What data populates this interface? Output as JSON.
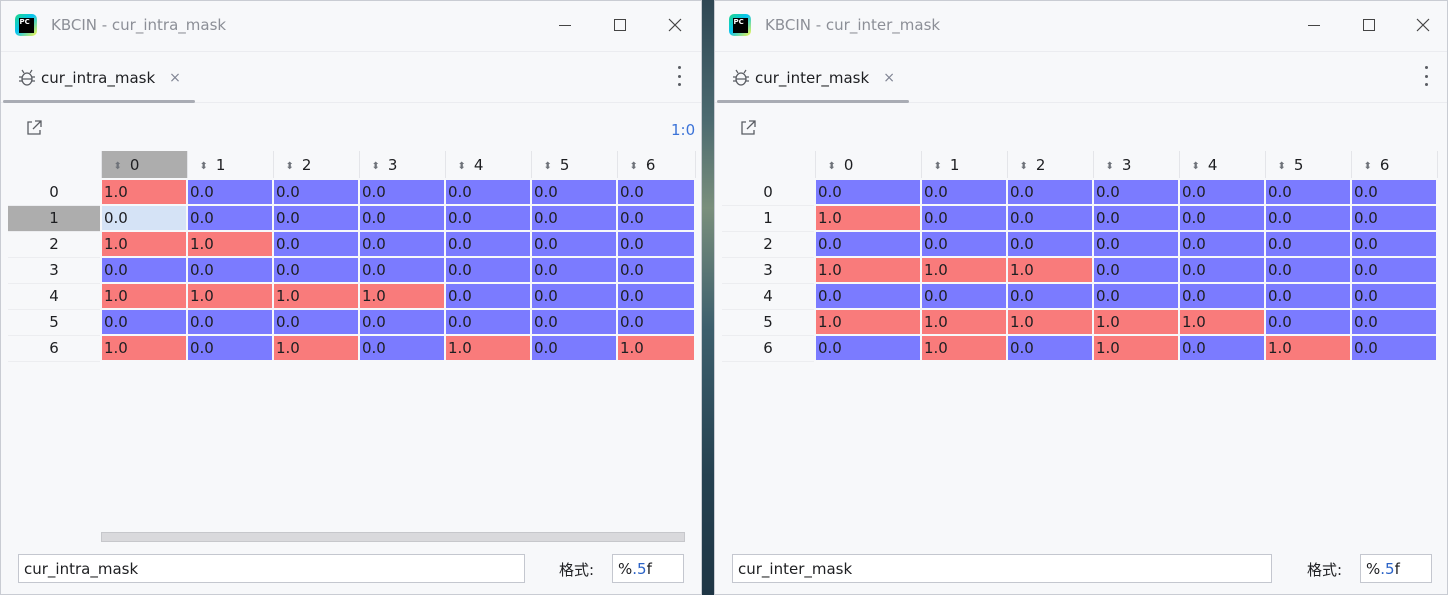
{
  "colors": {
    "one": "#f97b7b",
    "zero": "#7b7bff",
    "selected_cell": "#d5e3f6",
    "header_selected": "#adadad"
  },
  "left": {
    "window_title": "KBCIN - cur_intra_mask",
    "tab_label": "cur_intra_mask",
    "tab_close": "×",
    "ratio": "1:0",
    "columns": [
      "0",
      "1",
      "2",
      "3",
      "4",
      "5",
      "6"
    ],
    "rows": [
      {
        "index": "0",
        "cells": [
          "1.0",
          "0.0",
          "0.0",
          "0.0",
          "0.0",
          "0.0",
          "0.0"
        ]
      },
      {
        "index": "1",
        "cells": [
          "0.0",
          "0.0",
          "0.0",
          "0.0",
          "0.0",
          "0.0",
          "0.0"
        ]
      },
      {
        "index": "2",
        "cells": [
          "1.0",
          "1.0",
          "0.0",
          "0.0",
          "0.0",
          "0.0",
          "0.0"
        ]
      },
      {
        "index": "3",
        "cells": [
          "0.0",
          "0.0",
          "0.0",
          "0.0",
          "0.0",
          "0.0",
          "0.0"
        ]
      },
      {
        "index": "4",
        "cells": [
          "1.0",
          "1.0",
          "1.0",
          "1.0",
          "0.0",
          "0.0",
          "0.0"
        ]
      },
      {
        "index": "5",
        "cells": [
          "0.0",
          "0.0",
          "0.0",
          "0.0",
          "0.0",
          "0.0",
          "0.0"
        ]
      },
      {
        "index": "6",
        "cells": [
          "1.0",
          "0.0",
          "1.0",
          "0.0",
          "1.0",
          "0.0",
          "1.0"
        ]
      }
    ],
    "expression": "cur_intra_mask",
    "format_label": "格式:",
    "format_prefix": "%",
    "format_number": ".5",
    "format_suffix": "f"
  },
  "right": {
    "window_title": "KBCIN - cur_inter_mask",
    "tab_label": "cur_inter_mask",
    "tab_close": "×",
    "columns": [
      "0",
      "1",
      "2",
      "3",
      "4",
      "5",
      "6"
    ],
    "rows": [
      {
        "index": "0",
        "cells": [
          "0.0",
          "0.0",
          "0.0",
          "0.0",
          "0.0",
          "0.0",
          "0.0"
        ]
      },
      {
        "index": "1",
        "cells": [
          "1.0",
          "0.0",
          "0.0",
          "0.0",
          "0.0",
          "0.0",
          "0.0"
        ]
      },
      {
        "index": "2",
        "cells": [
          "0.0",
          "0.0",
          "0.0",
          "0.0",
          "0.0",
          "0.0",
          "0.0"
        ]
      },
      {
        "index": "3",
        "cells": [
          "1.0",
          "1.0",
          "1.0",
          "0.0",
          "0.0",
          "0.0",
          "0.0"
        ]
      },
      {
        "index": "4",
        "cells": [
          "0.0",
          "0.0",
          "0.0",
          "0.0",
          "0.0",
          "0.0",
          "0.0"
        ]
      },
      {
        "index": "5",
        "cells": [
          "1.0",
          "1.0",
          "1.0",
          "1.0",
          "1.0",
          "0.0",
          "0.0"
        ]
      },
      {
        "index": "6",
        "cells": [
          "0.0",
          "1.0",
          "0.0",
          "1.0",
          "0.0",
          "1.0",
          "0.0"
        ]
      }
    ],
    "expression": "cur_inter_mask",
    "format_label": "格式:",
    "format_prefix": "%",
    "format_number": ".5",
    "format_suffix": "f"
  },
  "icons": {
    "app": "pycharm-icon",
    "tab": "debug-bug-icon",
    "expand": "open-in-new-window-icon",
    "sort": "sort-icon",
    "minimize": "minimize-icon",
    "maximize": "maximize-icon",
    "close": "close-icon",
    "more": "more-vertical-icon"
  }
}
